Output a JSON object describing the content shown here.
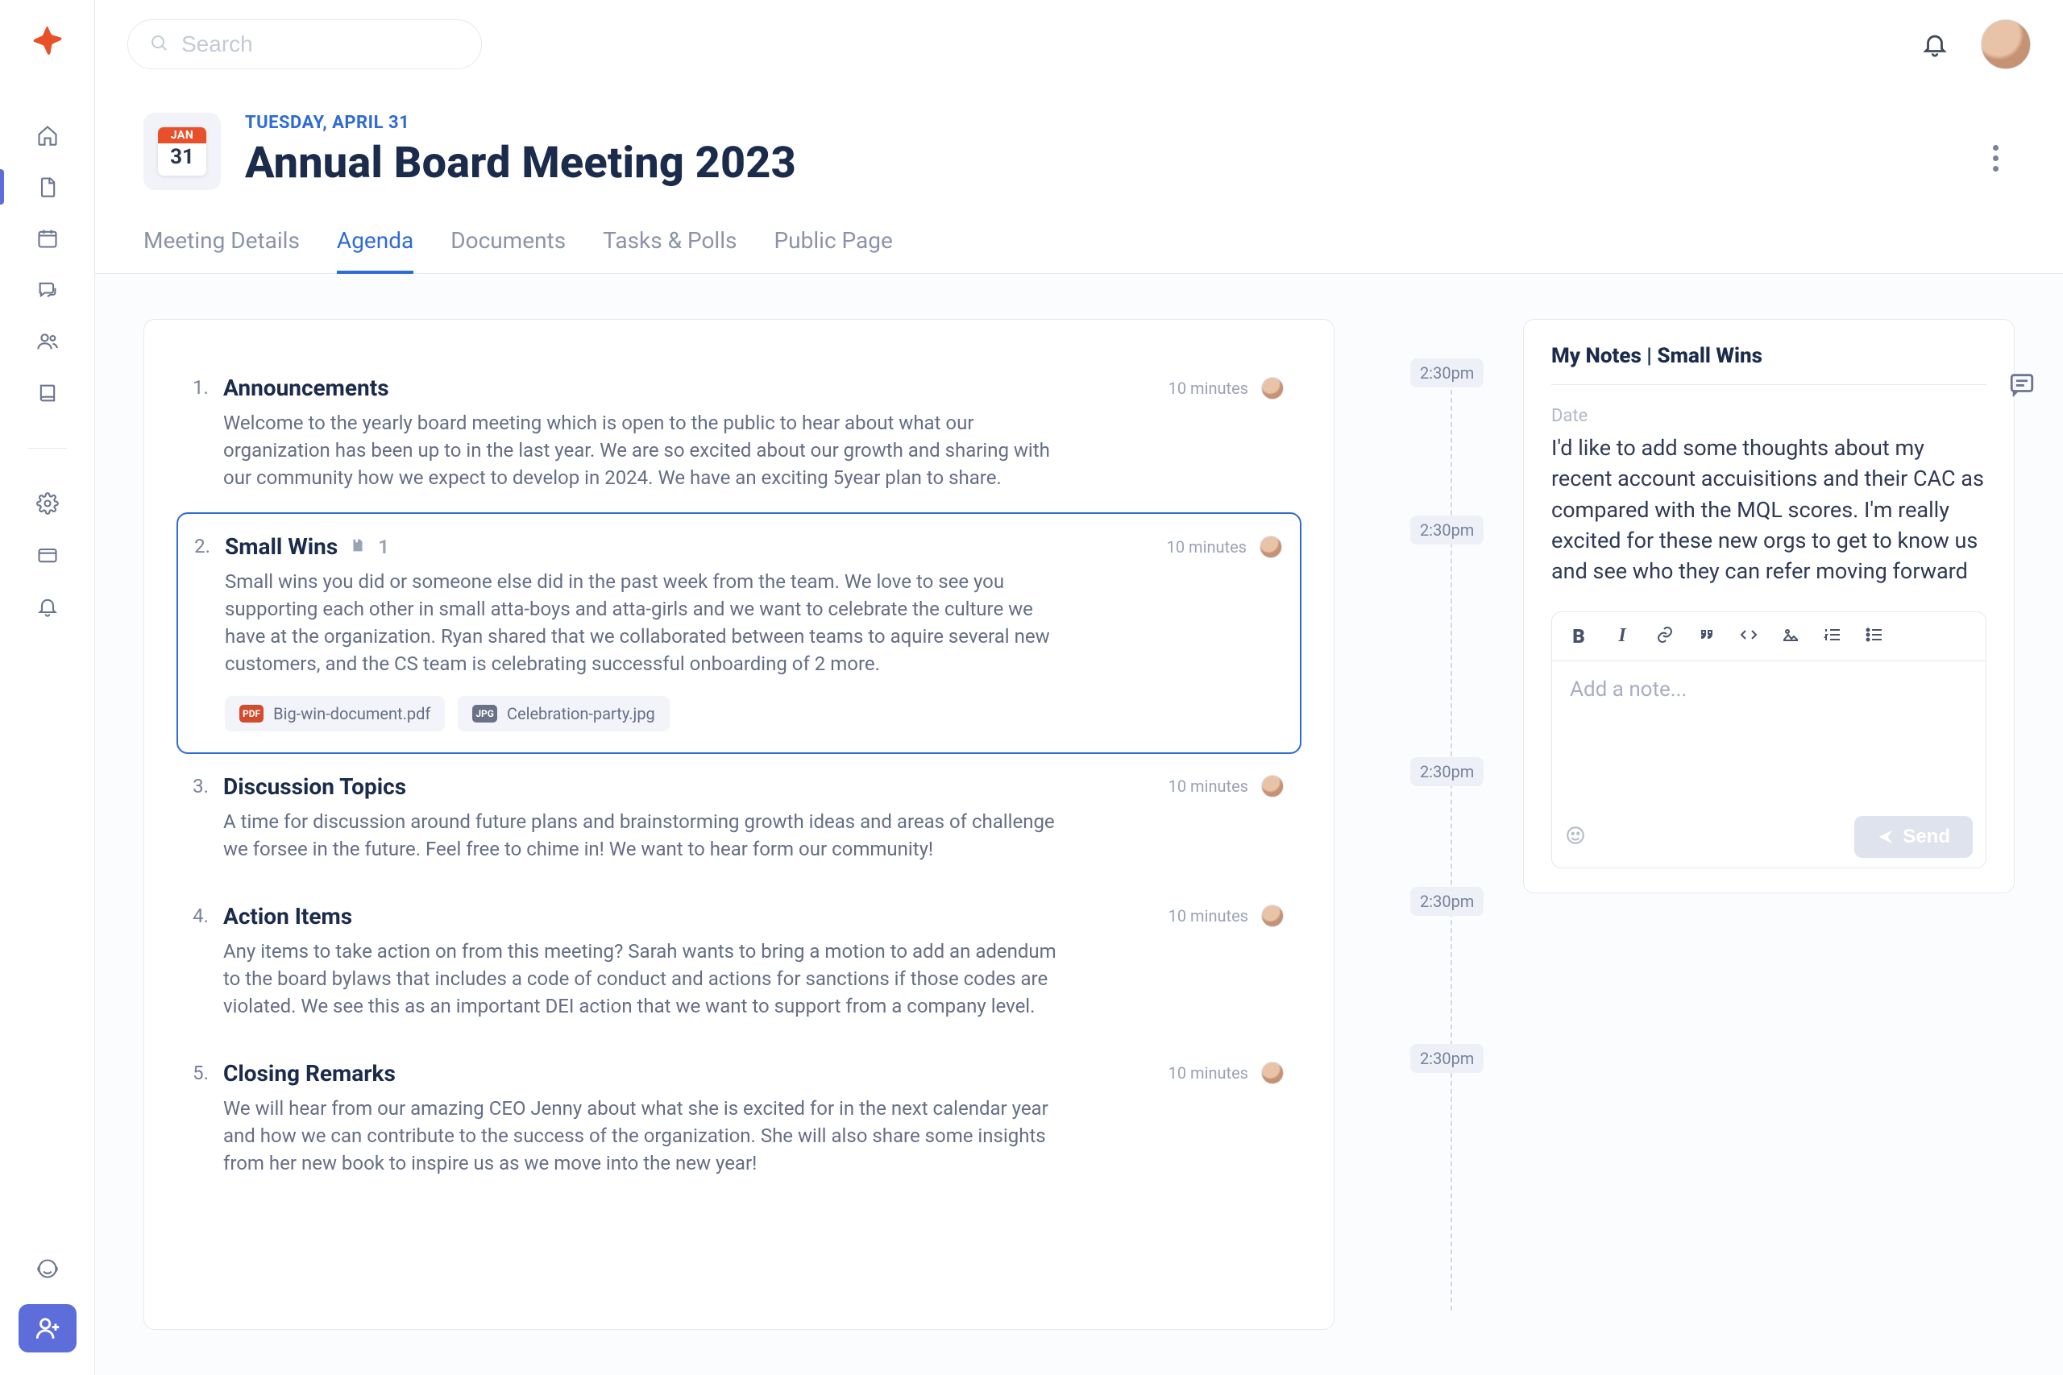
{
  "search": {
    "placeholder": "Search"
  },
  "header": {
    "date_label": "TUESDAY, APRIL 31",
    "title": "Annual Board Meeting 2023",
    "cal_month": "JAN",
    "cal_day": "31"
  },
  "tabs": [
    {
      "label": "Meeting Details",
      "active": false
    },
    {
      "label": "Agenda",
      "active": true
    },
    {
      "label": "Documents",
      "active": false
    },
    {
      "label": "Tasks & Polls",
      "active": false
    },
    {
      "label": "Public Page",
      "active": false
    }
  ],
  "agenda": [
    {
      "num": "1.",
      "title": "Announcements",
      "duration": "10 minutes",
      "time": "2:30pm",
      "desc": "Welcome to the yearly board meeting which is open to the public to hear about what our organization has been up to in the last year. We are so excited about our growth and sharing with our community how we expect to develop in 2024. We have an exciting 5year plan to share."
    },
    {
      "num": "2.",
      "title": "Small Wins",
      "duration": "10 minutes",
      "time": "2:30pm",
      "desc": "Small wins you did or someone else did in the past week from the team. We love to see you supporting each other in small atta-boys and atta-girls and we want to celebrate the culture we have at the organization. Ryan shared that we collaborated between teams to aquire several new customers, and the CS team is celebrating successful onboarding of 2 more.",
      "attach_count": "1",
      "files": [
        {
          "name": "Big-win-document.pdf",
          "type": "PDF"
        },
        {
          "name": "Celebration-party.jpg",
          "type": "JPG"
        }
      ]
    },
    {
      "num": "3.",
      "title": "Discussion Topics",
      "duration": "10 minutes",
      "time": "2:30pm",
      "desc": "A time for discussion around future plans and brainstorming growth ideas and areas of challenge we forsee in the future. Feel free to chime in! We want to hear form our community!"
    },
    {
      "num": "4.",
      "title": "Action Items",
      "duration": "10 minutes",
      "time": "2:30pm",
      "desc": "Any items to take action on from this meeting? Sarah wants to bring a motion to add an adendum to the board bylaws that includes a code of conduct and actions for sanctions if those codes are violated. We see this as an important DEI action that we want to support from a company level."
    },
    {
      "num": "5.",
      "title": "Closing Remarks",
      "duration": "10 minutes",
      "time": "2:30pm",
      "desc": "We will hear from our amazing CEO Jenny about what she is excited for in the next calendar year and how we can contribute to the success of the organization. She will also share some insights from her new book to inspire us as we move into the new year!"
    }
  ],
  "notes": {
    "title": "My Notes | Small Wins",
    "date_label": "Date",
    "body": "I'd like to add some thoughts about my recent account accuisitions and their CAC as compared with the MQL scores. I'm really excited for these new orgs to get to know us and see who they can refer moving forward",
    "placeholder": "Add a note...",
    "send_label": "Send"
  }
}
